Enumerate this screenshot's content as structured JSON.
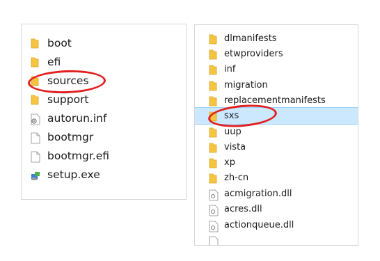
{
  "left_panel": {
    "items": [
      {
        "label": "boot",
        "icon": "folder-icon"
      },
      {
        "label": "efi",
        "icon": "folder-icon"
      },
      {
        "label": "sources",
        "icon": "folder-icon"
      },
      {
        "label": "support",
        "icon": "folder-icon"
      },
      {
        "label": "autorun.inf",
        "icon": "settings-file-icon"
      },
      {
        "label": "bootmgr",
        "icon": "file-icon"
      },
      {
        "label": "bootmgr.efi",
        "icon": "file-icon"
      },
      {
        "label": "setup.exe",
        "icon": "setup-exe-icon"
      }
    ]
  },
  "right_panel": {
    "selected": "sxs",
    "items": [
      {
        "label": "dlmanifests",
        "icon": "folder-icon"
      },
      {
        "label": "etwproviders",
        "icon": "folder-icon"
      },
      {
        "label": "inf",
        "icon": "folder-icon"
      },
      {
        "label": "migration",
        "icon": "folder-icon"
      },
      {
        "label": "replacementmanifests",
        "icon": "folder-icon"
      },
      {
        "label": "sxs",
        "icon": "folder-icon"
      },
      {
        "label": "uup",
        "icon": "folder-icon"
      },
      {
        "label": "vista",
        "icon": "folder-icon"
      },
      {
        "label": "xp",
        "icon": "folder-icon"
      },
      {
        "label": "zh-cn",
        "icon": "folder-icon"
      },
      {
        "label": "acmigration.dll",
        "icon": "dll-file-icon"
      },
      {
        "label": "acres.dll",
        "icon": "dll-file-icon"
      },
      {
        "label": "actionqueue.dll",
        "icon": "dll-file-icon"
      },
      {
        "label": "",
        "icon": "dll-file-icon"
      }
    ]
  },
  "colors": {
    "folder": "#f5c542",
    "highlight_circle": "#e02020",
    "selection_bg": "#cce8ff"
  }
}
